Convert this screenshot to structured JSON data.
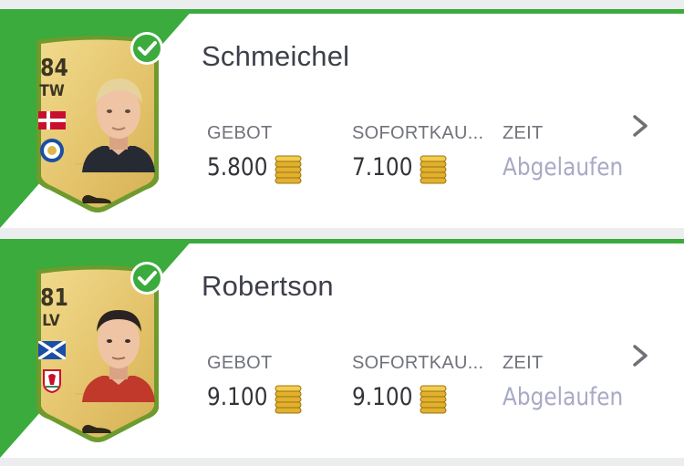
{
  "columns": {
    "bid_label": "GEBOT",
    "buynow_label": "SOFORTKAU...",
    "time_label": "ZEIT"
  },
  "colors": {
    "accent": "#3aab3c",
    "card_gold": "#e9cf7a",
    "expired_text": "#a8a9c6"
  },
  "icons": {
    "check": "check-circle-icon",
    "coin": "coins-icon",
    "chevron": "chevron-right-icon",
    "boot": "boot-icon"
  },
  "listings": [
    {
      "name": "Schmeichel",
      "rating": "84",
      "position": "TW",
      "nation_flag": "denmark-flag-icon",
      "club_badge": "leicester-badge-icon",
      "bid": "5.800",
      "buy_now": "7.100",
      "time": "Abgelaufen"
    },
    {
      "name": "Robertson",
      "rating": "81",
      "position": "LV",
      "nation_flag": "scotland-flag-icon",
      "club_badge": "liverpool-badge-icon",
      "bid": "9.100",
      "buy_now": "9.100",
      "time": "Abgelaufen"
    }
  ]
}
